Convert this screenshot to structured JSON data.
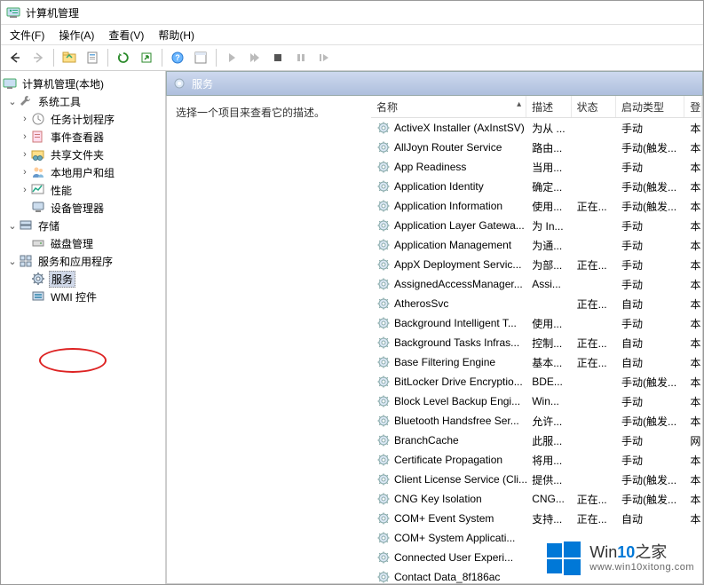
{
  "title": "计算机管理",
  "menu": {
    "file": "文件(F)",
    "action": "操作(A)",
    "view": "查看(V)",
    "help": "帮助(H)"
  },
  "tree": {
    "root": "计算机管理(本地)",
    "system_tools": "系统工具",
    "task_scheduler": "任务计划程序",
    "event_viewer": "事件查看器",
    "shared_folders": "共享文件夹",
    "local_users": "本地用户和组",
    "performance": "性能",
    "device_manager": "设备管理器",
    "storage": "存储",
    "disk_mgmt": "磁盘管理",
    "services_apps": "服务和应用程序",
    "services": "服务",
    "wmi": "WMI 控件"
  },
  "right_header": "服务",
  "desc_hint": "选择一个项目来查看它的描述。",
  "cols": {
    "name": "名称",
    "desc": "描述",
    "status": "状态",
    "start": "启动类型",
    "login": "登"
  },
  "services": [
    {
      "n": "ActiveX Installer (AxInstSV)",
      "d": "为从 ...",
      "s": "",
      "t": "手动",
      "l": "本"
    },
    {
      "n": "AllJoyn Router Service",
      "d": "路由...",
      "s": "",
      "t": "手动(触发...",
      "l": "本"
    },
    {
      "n": "App Readiness",
      "d": "当用...",
      "s": "",
      "t": "手动",
      "l": "本"
    },
    {
      "n": "Application Identity",
      "d": "确定...",
      "s": "",
      "t": "手动(触发...",
      "l": "本"
    },
    {
      "n": "Application Information",
      "d": "使用...",
      "s": "正在...",
      "t": "手动(触发...",
      "l": "本"
    },
    {
      "n": "Application Layer Gatewa...",
      "d": "为 In...",
      "s": "",
      "t": "手动",
      "l": "本"
    },
    {
      "n": "Application Management",
      "d": "为通...",
      "s": "",
      "t": "手动",
      "l": "本"
    },
    {
      "n": "AppX Deployment Servic...",
      "d": "为部...",
      "s": "正在...",
      "t": "手动",
      "l": "本"
    },
    {
      "n": "AssignedAccessManager...",
      "d": "Assi...",
      "s": "",
      "t": "手动",
      "l": "本"
    },
    {
      "n": "AtherosSvc",
      "d": "",
      "s": "正在...",
      "t": "自动",
      "l": "本"
    },
    {
      "n": "Background Intelligent T...",
      "d": "使用...",
      "s": "",
      "t": "手动",
      "l": "本"
    },
    {
      "n": "Background Tasks Infras...",
      "d": "控制...",
      "s": "正在...",
      "t": "自动",
      "l": "本"
    },
    {
      "n": "Base Filtering Engine",
      "d": "基本...",
      "s": "正在...",
      "t": "自动",
      "l": "本"
    },
    {
      "n": "BitLocker Drive Encryptio...",
      "d": "BDE...",
      "s": "",
      "t": "手动(触发...",
      "l": "本"
    },
    {
      "n": "Block Level Backup Engi...",
      "d": "Win...",
      "s": "",
      "t": "手动",
      "l": "本"
    },
    {
      "n": "Bluetooth Handsfree Ser...",
      "d": "允许...",
      "s": "",
      "t": "手动(触发...",
      "l": "本"
    },
    {
      "n": "BranchCache",
      "d": "此服...",
      "s": "",
      "t": "手动",
      "l": "网"
    },
    {
      "n": "Certificate Propagation",
      "d": "将用...",
      "s": "",
      "t": "手动",
      "l": "本"
    },
    {
      "n": "Client License Service (Cli...",
      "d": "提供...",
      "s": "",
      "t": "手动(触发...",
      "l": "本"
    },
    {
      "n": "CNG Key Isolation",
      "d": "CNG...",
      "s": "正在...",
      "t": "手动(触发...",
      "l": "本"
    },
    {
      "n": "COM+ Event System",
      "d": "支持...",
      "s": "正在...",
      "t": "自动",
      "l": "本"
    },
    {
      "n": "COM+ System Applicati...",
      "d": "",
      "s": "",
      "t": "",
      "l": ""
    },
    {
      "n": "Connected User Experi...",
      "d": "",
      "s": "",
      "t": "",
      "l": ""
    },
    {
      "n": "Contact Data_8f186ac",
      "d": "",
      "s": "",
      "t": "",
      "l": ""
    }
  ],
  "watermark": {
    "brand_a": "Win",
    "brand_b": "10",
    "brand_c": "之家",
    "url": "www.win10xitong.com"
  }
}
